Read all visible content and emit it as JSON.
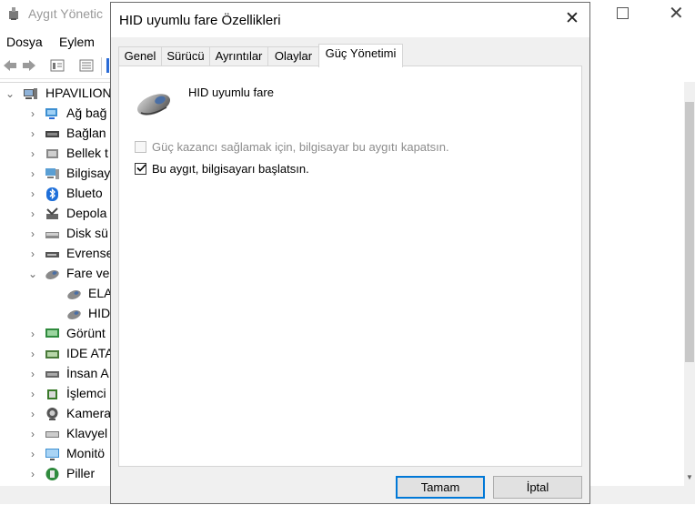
{
  "device_manager": {
    "title": "Aygıt Yönetic",
    "menu": [
      "Dosya",
      "Eylem"
    ],
    "root": "HPAVILION",
    "tree": [
      {
        "label": "Ağ bağ",
        "icon": "network-adapter-icon",
        "chevron": "›"
      },
      {
        "label": "Bağlan",
        "icon": "connector-icon",
        "chevron": "›"
      },
      {
        "label": "Bellek t",
        "icon": "memory-icon",
        "chevron": "›"
      },
      {
        "label": "Bilgisay",
        "icon": "computer-icon",
        "chevron": "›"
      },
      {
        "label": "Blueto",
        "icon": "bluetooth-icon",
        "chevron": "›"
      },
      {
        "label": "Depola",
        "icon": "storage-icon",
        "chevron": "›"
      },
      {
        "label": "Disk sü",
        "icon": "disk-drive-icon",
        "chevron": "›"
      },
      {
        "label": "Evrense",
        "icon": "usb-controller-icon",
        "chevron": "›"
      },
      {
        "label": "Fare ve",
        "icon": "mouse-icon",
        "chevron": "⌄"
      },
      {
        "label": "ELA",
        "icon": "mouse-icon",
        "chevron": "",
        "child": true
      },
      {
        "label": "HID",
        "icon": "mouse-icon",
        "chevron": "",
        "child": true
      },
      {
        "label": "Görünt",
        "icon": "display-adapter-icon",
        "chevron": "›"
      },
      {
        "label": "IDE ATA",
        "icon": "ide-controller-icon",
        "chevron": "›"
      },
      {
        "label": "İnsan A",
        "icon": "hid-device-icon",
        "chevron": "›"
      },
      {
        "label": "İşlemci",
        "icon": "processor-icon",
        "chevron": "›"
      },
      {
        "label": "Kamera",
        "icon": "camera-icon",
        "chevron": "›"
      },
      {
        "label": "Klavyel",
        "icon": "keyboard-icon",
        "chevron": "›"
      },
      {
        "label": "Monitö",
        "icon": "monitor-icon",
        "chevron": "›"
      },
      {
        "label": "Piller",
        "icon": "battery-icon",
        "chevron": "›"
      }
    ]
  },
  "dialog": {
    "title": "HID uyumlu fare Özellikleri",
    "close_symbol": "✕",
    "tabs": [
      "Genel",
      "Sürücü",
      "Ayrıntılar",
      "Olaylar",
      "Güç Yönetimi"
    ],
    "active_tab": "Güç Yönetimi",
    "device_name": "HID uyumlu fare",
    "options": [
      {
        "label": "Güç kazancı sağlamak için, bilgisayar bu aygıtı kapatsın.",
        "checked": false,
        "enabled": false
      },
      {
        "label": "Bu aygıt, bilgisayarı başlatsın.",
        "checked": true,
        "enabled": true
      }
    ],
    "ok_label": "Tamam",
    "cancel_label": "İptal"
  },
  "colors": {
    "accent": "#0078d7",
    "dialog_bg": "#f0f0f0",
    "disabled_text": "#8c8c8c"
  }
}
